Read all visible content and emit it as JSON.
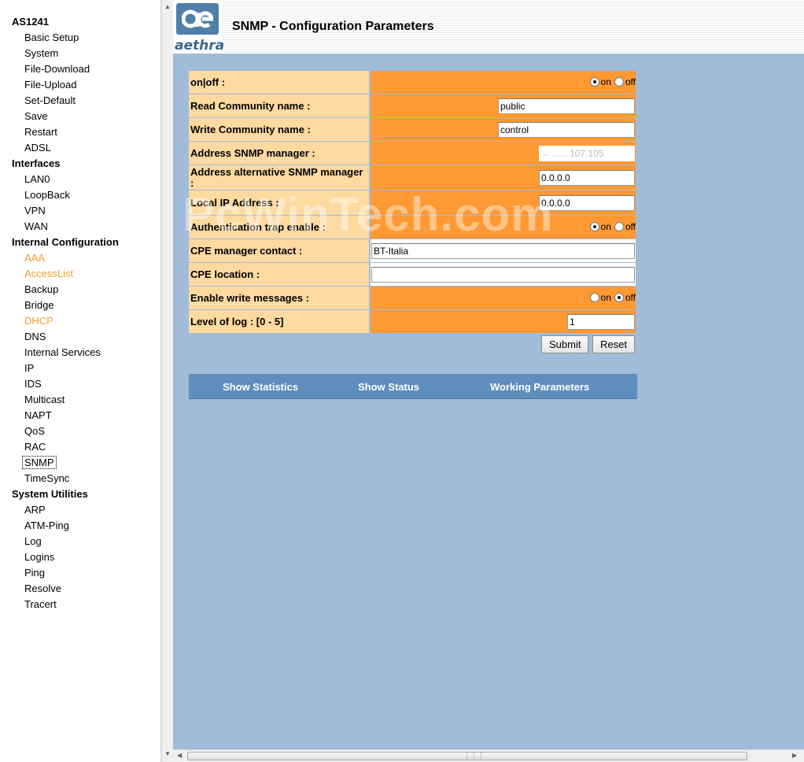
{
  "nav": {
    "device_title": "AS1241",
    "groups": [
      {
        "label": "",
        "items": [
          {
            "label": "Basic Setup",
            "visited": false
          },
          {
            "label": "System",
            "visited": false
          },
          {
            "label": "File-Download",
            "visited": false
          },
          {
            "label": "File-Upload",
            "visited": false
          },
          {
            "label": "Set-Default",
            "visited": false
          },
          {
            "label": "Save",
            "visited": false
          },
          {
            "label": "Restart",
            "visited": false
          },
          {
            "label": "ADSL",
            "visited": false
          }
        ]
      },
      {
        "label": "Interfaces",
        "items": [
          {
            "label": "LAN0",
            "visited": false
          },
          {
            "label": "LoopBack",
            "visited": false
          },
          {
            "label": "VPN",
            "visited": false
          },
          {
            "label": "WAN",
            "visited": false
          }
        ]
      },
      {
        "label": "Internal Configuration",
        "items": [
          {
            "label": "AAA",
            "visited": true
          },
          {
            "label": "AccessList",
            "visited": true
          },
          {
            "label": "Backup",
            "visited": false
          },
          {
            "label": "Bridge",
            "visited": false
          },
          {
            "label": "DHCP",
            "visited": true
          },
          {
            "label": "DNS",
            "visited": false
          },
          {
            "label": "Internal Services",
            "visited": false
          },
          {
            "label": "IP",
            "visited": false
          },
          {
            "label": "IDS",
            "visited": false
          },
          {
            "label": "Multicast",
            "visited": false
          },
          {
            "label": "NAPT",
            "visited": false
          },
          {
            "label": "QoS",
            "visited": false
          },
          {
            "label": "RAC",
            "visited": false
          },
          {
            "label": "SNMP",
            "visited": false,
            "focused": true
          },
          {
            "label": "TimeSync",
            "visited": false
          }
        ]
      },
      {
        "label": "System Utilities",
        "items": [
          {
            "label": "ARP",
            "visited": false
          },
          {
            "label": "ATM-Ping",
            "visited": false
          },
          {
            "label": "Log",
            "visited": false
          },
          {
            "label": "Logins",
            "visited": false
          },
          {
            "label": "Ping",
            "visited": false
          },
          {
            "label": "Resolve",
            "visited": false
          },
          {
            "label": "Tracert",
            "visited": false
          }
        ]
      }
    ]
  },
  "header": {
    "logo_text": "aethra",
    "title": "SNMP - Configuration Parameters"
  },
  "form": {
    "on_off": {
      "label": "on|off :",
      "on_label": "on",
      "off_label": "off",
      "selected": "on"
    },
    "read_community": {
      "label": "Read Community name :",
      "value": "public"
    },
    "write_community": {
      "label": "Write Community name :",
      "value": "control"
    },
    "snmp_manager": {
      "label": "Address SNMP manager :",
      "value": "←……107.105"
    },
    "alt_snmp_manager": {
      "label": "Address alternative SNMP manager :",
      "value": "0.0.0.0"
    },
    "local_ip": {
      "label": "Local IP Address :",
      "value": "0.0.0.0"
    },
    "auth_trap": {
      "label": "Authentication trap enable :",
      "on_label": "on",
      "off_label": "off",
      "selected": "on"
    },
    "cpe_contact": {
      "label": "CPE manager contact :",
      "value": "BT-Italia"
    },
    "cpe_location": {
      "label": "CPE location :",
      "value": ""
    },
    "write_messages": {
      "label": "Enable write messages :",
      "on_label": "on",
      "off_label": "off",
      "selected": "off"
    },
    "log_level": {
      "label": "Level of log : [0 - 5]",
      "value": "1"
    },
    "submit_label": "Submit",
    "reset_label": "Reset"
  },
  "links": {
    "show_statistics": "Show Statistics",
    "show_status": "Show Status",
    "working_parameters": "Working Parameters"
  },
  "watermark": "PcWinTech.com",
  "colors": {
    "label_bg": "#fed9a0",
    "value_bg": "#ff9933",
    "page_bg": "#a1bcd8",
    "link_bar_bg": "#5f8ebd",
    "visited_link": "#f0a030"
  }
}
